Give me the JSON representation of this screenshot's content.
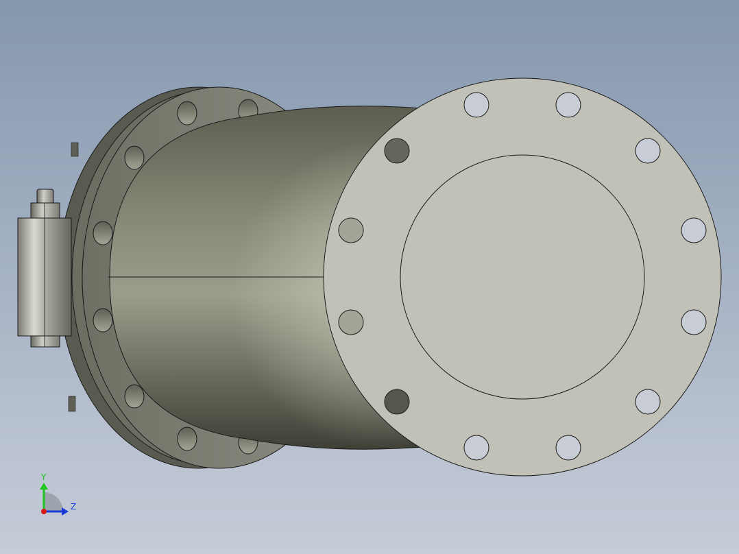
{
  "viewport": {
    "background_top": "#8597ae",
    "background_bottom": "#c6ccd8"
  },
  "model": {
    "flange_face_color": "#c2c1b7",
    "body_color": "#8a8b78",
    "edge_color": "#1a1a1a",
    "bolt_holes_front_count": 12,
    "bolt_holes_rear_visible": 10
  },
  "triad": {
    "y_label": "Y",
    "z_label": "Z",
    "y_color": "#1fc41f",
    "z_color": "#1a3bd6",
    "x_color": "#d61a1a"
  }
}
